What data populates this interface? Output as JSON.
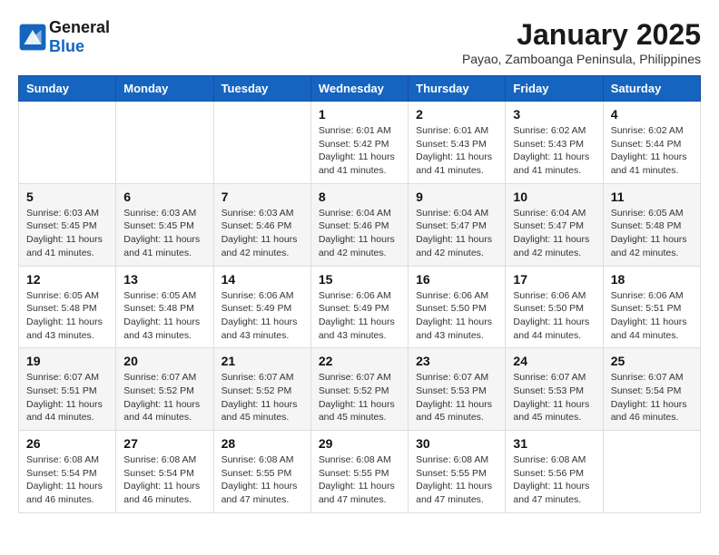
{
  "header": {
    "logo_general": "General",
    "logo_blue": "Blue",
    "month_title": "January 2025",
    "location": "Payao, Zamboanga Peninsula, Philippines"
  },
  "weekdays": [
    "Sunday",
    "Monday",
    "Tuesday",
    "Wednesday",
    "Thursday",
    "Friday",
    "Saturday"
  ],
  "weeks": [
    [
      {
        "day": "",
        "info": ""
      },
      {
        "day": "",
        "info": ""
      },
      {
        "day": "",
        "info": ""
      },
      {
        "day": "1",
        "info": "Sunrise: 6:01 AM\nSunset: 5:42 PM\nDaylight: 11 hours\nand 41 minutes."
      },
      {
        "day": "2",
        "info": "Sunrise: 6:01 AM\nSunset: 5:43 PM\nDaylight: 11 hours\nand 41 minutes."
      },
      {
        "day": "3",
        "info": "Sunrise: 6:02 AM\nSunset: 5:43 PM\nDaylight: 11 hours\nand 41 minutes."
      },
      {
        "day": "4",
        "info": "Sunrise: 6:02 AM\nSunset: 5:44 PM\nDaylight: 11 hours\nand 41 minutes."
      }
    ],
    [
      {
        "day": "5",
        "info": "Sunrise: 6:03 AM\nSunset: 5:45 PM\nDaylight: 11 hours\nand 41 minutes."
      },
      {
        "day": "6",
        "info": "Sunrise: 6:03 AM\nSunset: 5:45 PM\nDaylight: 11 hours\nand 41 minutes."
      },
      {
        "day": "7",
        "info": "Sunrise: 6:03 AM\nSunset: 5:46 PM\nDaylight: 11 hours\nand 42 minutes."
      },
      {
        "day": "8",
        "info": "Sunrise: 6:04 AM\nSunset: 5:46 PM\nDaylight: 11 hours\nand 42 minutes."
      },
      {
        "day": "9",
        "info": "Sunrise: 6:04 AM\nSunset: 5:47 PM\nDaylight: 11 hours\nand 42 minutes."
      },
      {
        "day": "10",
        "info": "Sunrise: 6:04 AM\nSunset: 5:47 PM\nDaylight: 11 hours\nand 42 minutes."
      },
      {
        "day": "11",
        "info": "Sunrise: 6:05 AM\nSunset: 5:48 PM\nDaylight: 11 hours\nand 42 minutes."
      }
    ],
    [
      {
        "day": "12",
        "info": "Sunrise: 6:05 AM\nSunset: 5:48 PM\nDaylight: 11 hours\nand 43 minutes."
      },
      {
        "day": "13",
        "info": "Sunrise: 6:05 AM\nSunset: 5:48 PM\nDaylight: 11 hours\nand 43 minutes."
      },
      {
        "day": "14",
        "info": "Sunrise: 6:06 AM\nSunset: 5:49 PM\nDaylight: 11 hours\nand 43 minutes."
      },
      {
        "day": "15",
        "info": "Sunrise: 6:06 AM\nSunset: 5:49 PM\nDaylight: 11 hours\nand 43 minutes."
      },
      {
        "day": "16",
        "info": "Sunrise: 6:06 AM\nSunset: 5:50 PM\nDaylight: 11 hours\nand 43 minutes."
      },
      {
        "day": "17",
        "info": "Sunrise: 6:06 AM\nSunset: 5:50 PM\nDaylight: 11 hours\nand 44 minutes."
      },
      {
        "day": "18",
        "info": "Sunrise: 6:06 AM\nSunset: 5:51 PM\nDaylight: 11 hours\nand 44 minutes."
      }
    ],
    [
      {
        "day": "19",
        "info": "Sunrise: 6:07 AM\nSunset: 5:51 PM\nDaylight: 11 hours\nand 44 minutes."
      },
      {
        "day": "20",
        "info": "Sunrise: 6:07 AM\nSunset: 5:52 PM\nDaylight: 11 hours\nand 44 minutes."
      },
      {
        "day": "21",
        "info": "Sunrise: 6:07 AM\nSunset: 5:52 PM\nDaylight: 11 hours\nand 45 minutes."
      },
      {
        "day": "22",
        "info": "Sunrise: 6:07 AM\nSunset: 5:52 PM\nDaylight: 11 hours\nand 45 minutes."
      },
      {
        "day": "23",
        "info": "Sunrise: 6:07 AM\nSunset: 5:53 PM\nDaylight: 11 hours\nand 45 minutes."
      },
      {
        "day": "24",
        "info": "Sunrise: 6:07 AM\nSunset: 5:53 PM\nDaylight: 11 hours\nand 45 minutes."
      },
      {
        "day": "25",
        "info": "Sunrise: 6:07 AM\nSunset: 5:54 PM\nDaylight: 11 hours\nand 46 minutes."
      }
    ],
    [
      {
        "day": "26",
        "info": "Sunrise: 6:08 AM\nSunset: 5:54 PM\nDaylight: 11 hours\nand 46 minutes."
      },
      {
        "day": "27",
        "info": "Sunrise: 6:08 AM\nSunset: 5:54 PM\nDaylight: 11 hours\nand 46 minutes."
      },
      {
        "day": "28",
        "info": "Sunrise: 6:08 AM\nSunset: 5:55 PM\nDaylight: 11 hours\nand 47 minutes."
      },
      {
        "day": "29",
        "info": "Sunrise: 6:08 AM\nSunset: 5:55 PM\nDaylight: 11 hours\nand 47 minutes."
      },
      {
        "day": "30",
        "info": "Sunrise: 6:08 AM\nSunset: 5:55 PM\nDaylight: 11 hours\nand 47 minutes."
      },
      {
        "day": "31",
        "info": "Sunrise: 6:08 AM\nSunset: 5:56 PM\nDaylight: 11 hours\nand 47 minutes."
      },
      {
        "day": "",
        "info": ""
      }
    ]
  ]
}
